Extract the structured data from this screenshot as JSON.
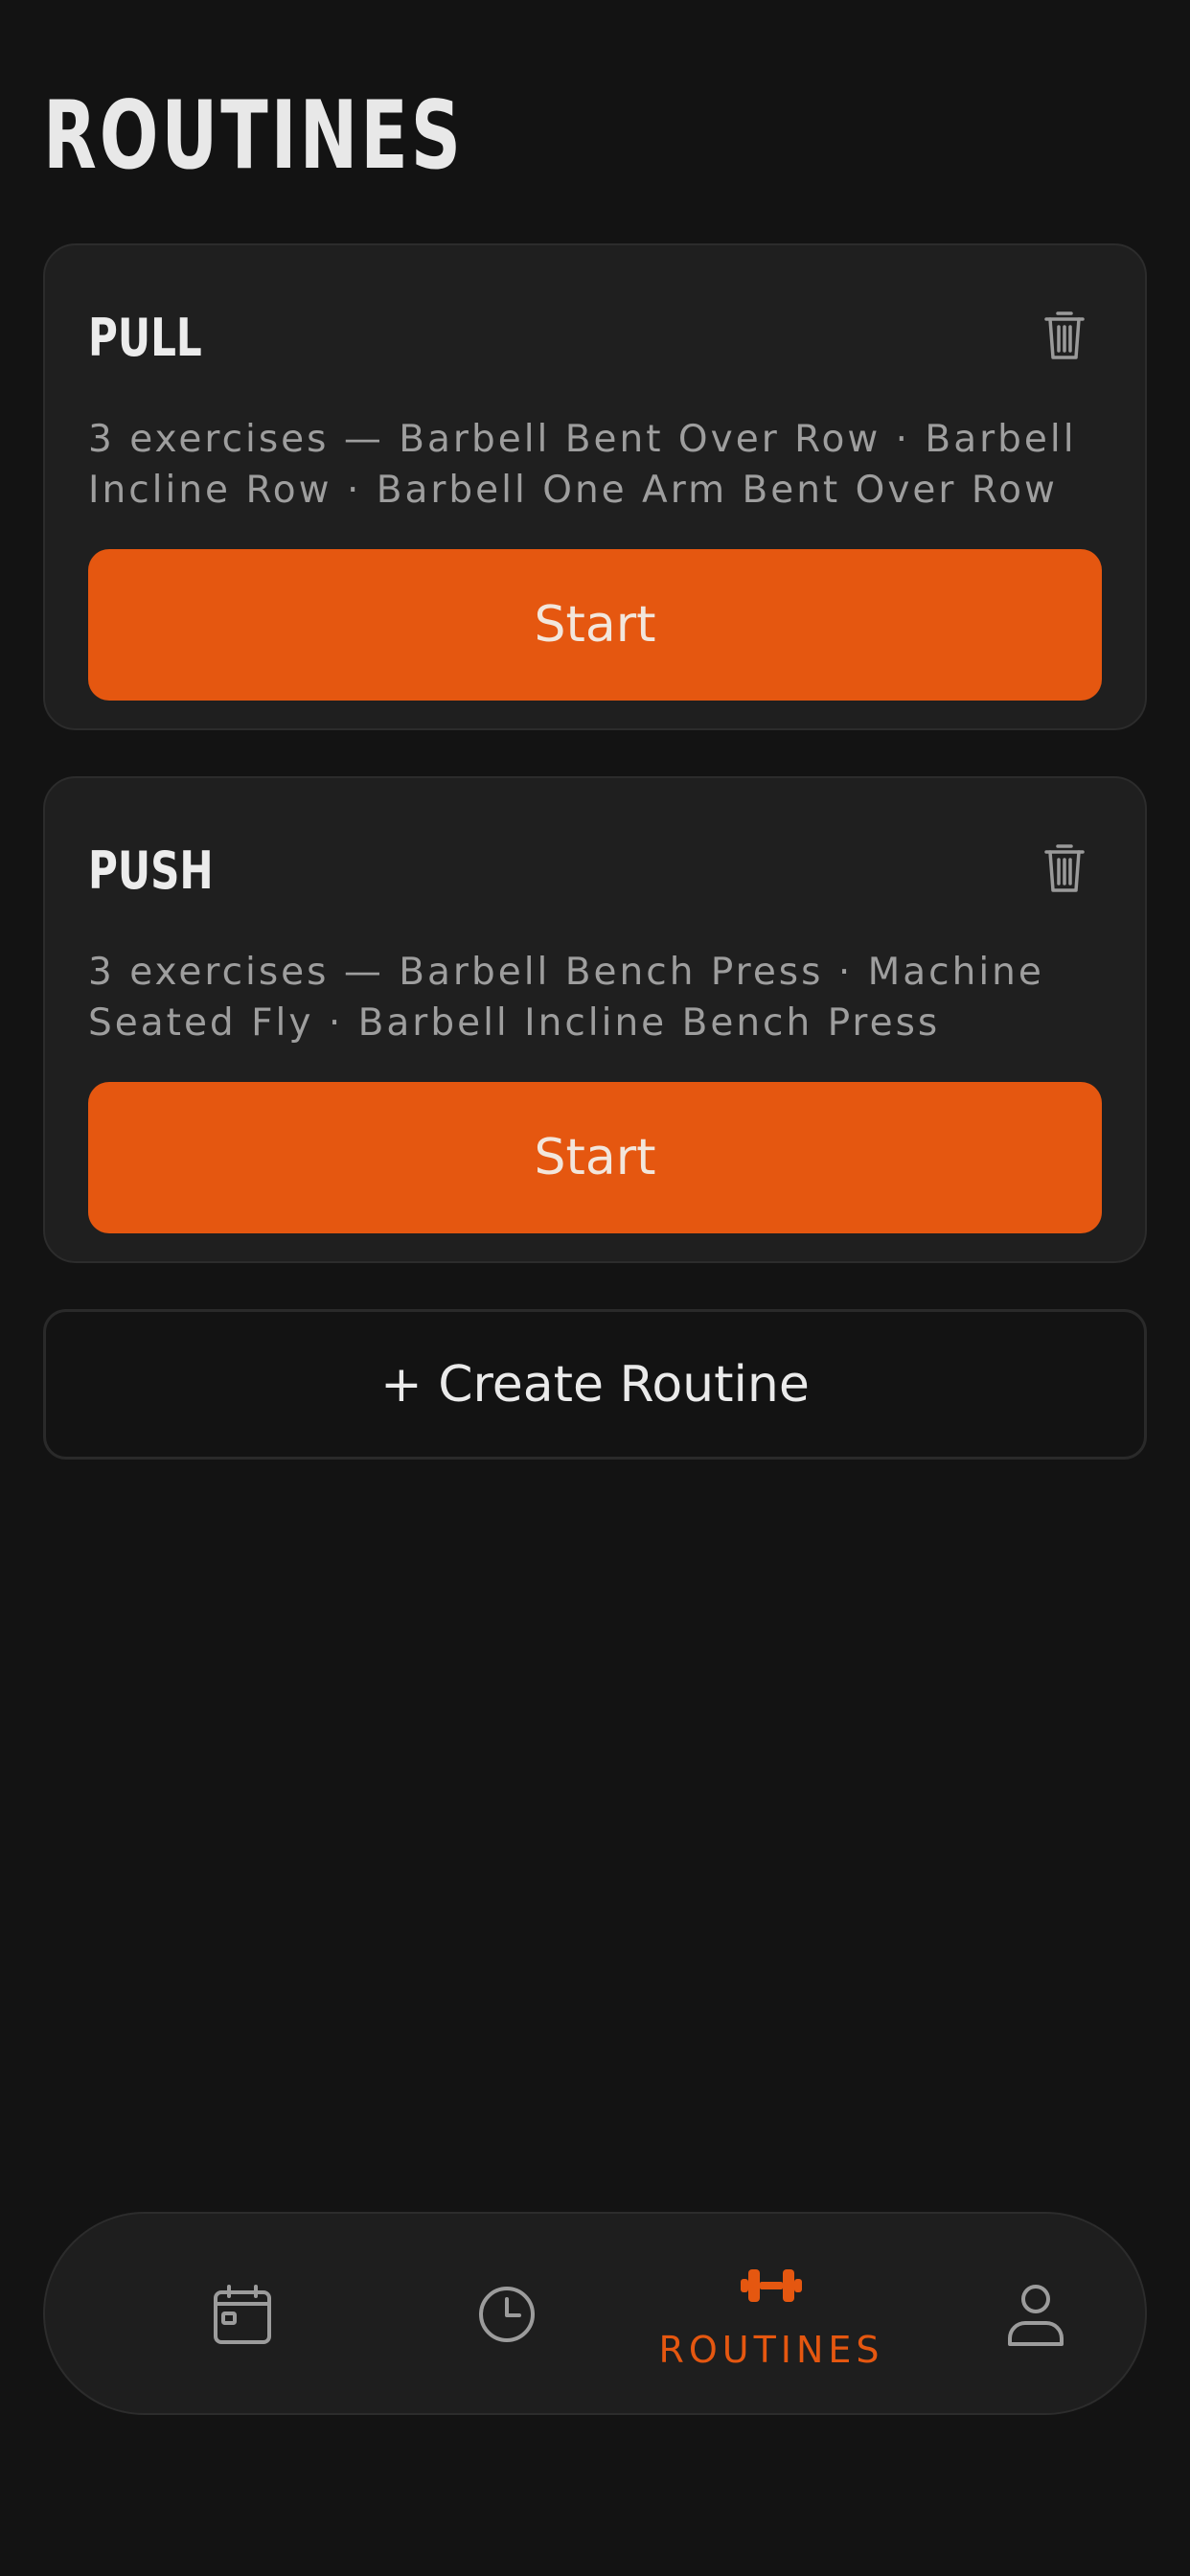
{
  "header": {
    "title": "ROUTINES"
  },
  "routines": [
    {
      "name": "PULL",
      "description": "3 exercises — Barbell Bent Over Row · Barbell Incline Row · Barbell One Arm Bent Over Row",
      "start_label": "Start",
      "delete_icon": "trash-icon"
    },
    {
      "name": "PUSH",
      "description": "3 exercises — Barbell Bench Press · Machine Seated Fly · Barbell Incline Bench Press",
      "start_label": "Start",
      "delete_icon": "trash-icon"
    }
  ],
  "create_button": {
    "label": "+ Create Routine"
  },
  "bottom_nav": {
    "items": [
      {
        "id": "calendar",
        "icon": "calendar-icon",
        "label": ""
      },
      {
        "id": "history",
        "icon": "clock-icon",
        "label": ""
      },
      {
        "id": "routines",
        "icon": "dumbbell-icon",
        "label": "ROUTINES",
        "active": true
      },
      {
        "id": "profile",
        "icon": "user-icon",
        "label": ""
      }
    ]
  },
  "colors": {
    "background": "#131313",
    "card": "#1f1f1f",
    "accent": "#e55710",
    "text_primary": "#e8e8e8",
    "text_secondary": "#9e9e9e"
  }
}
